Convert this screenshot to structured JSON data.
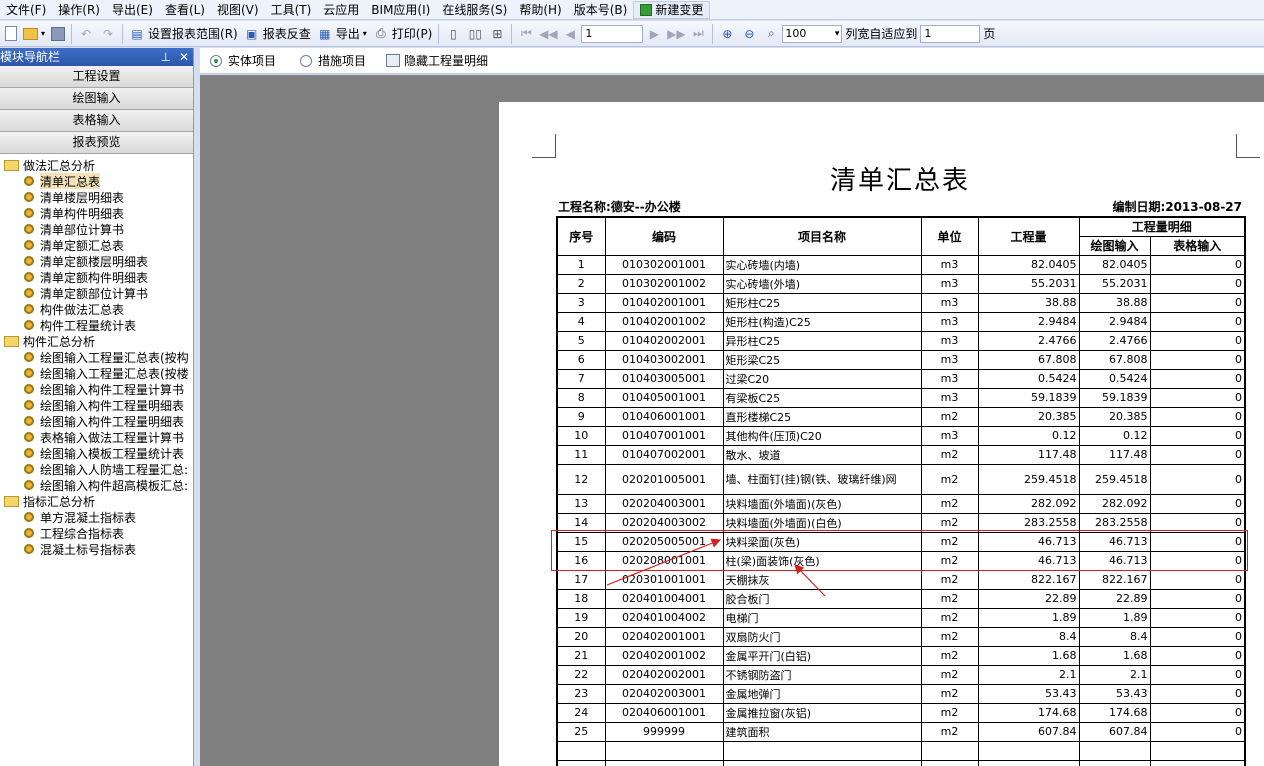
{
  "menu": [
    "文件(F)",
    "操作(R)",
    "导出(E)",
    "查看(L)",
    "视图(V)",
    "工具(T)",
    "云应用",
    "BIM应用(I)",
    "在线服务(S)",
    "帮助(H)",
    "版本号(B)"
  ],
  "menu_special": "新建变更",
  "toolbar": {
    "set_range": "设置报表范围(R)",
    "reverse": "报表反查",
    "export": "导出",
    "print": "打印(P)",
    "page_value": "1",
    "zoom_value": "100",
    "fit_label": "列宽自适应到",
    "fit_value": "1",
    "page_unit": "页"
  },
  "left_panel": {
    "title": "模块导航栏",
    "nav": [
      "工程设置",
      "绘图输入",
      "表格输入",
      "报表预览"
    ],
    "groups": [
      {
        "label": "做法汇总分析",
        "items": [
          "清单汇总表",
          "清单楼层明细表",
          "清单构件明细表",
          "清单部位计算书",
          "清单定额汇总表",
          "清单定额楼层明细表",
          "清单定额构件明细表",
          "清单定额部位计算书",
          "构件做法汇总表",
          "构件工程量统计表"
        ]
      },
      {
        "label": "构件汇总分析",
        "items": [
          "绘图输入工程量汇总表(按构",
          "绘图输入工程量汇总表(按楼",
          "绘图输入构件工程量计算书",
          "绘图输入构件工程量明细表",
          "绘图输入构件工程量明细表",
          "表格输入做法工程量计算书",
          "绘图输入模板工程量统计表",
          "绘图输入人防墙工程量汇总:",
          "绘图输入构件超高模板汇总:"
        ]
      },
      {
        "label": "指标汇总分析",
        "items": [
          "单方混凝土指标表",
          "工程综合指标表",
          "混凝土标号指标表"
        ]
      }
    ]
  },
  "tabs": {
    "entity": "实体项目",
    "measure": "措施项目",
    "hide": "隐藏工程量明细"
  },
  "report": {
    "title": "清单汇总表",
    "project": "工程名称:德安--办公楼",
    "date": "编制日期:2013-08-27",
    "headers": {
      "seq": "序号",
      "code": "编码",
      "name": "项目名称",
      "unit": "单位",
      "qty": "工程量",
      "detail": "工程量明细",
      "draw": "绘图输入",
      "table": "表格输入"
    },
    "rows": [
      {
        "seq": "1",
        "code": "010302001001",
        "name": "实心砖墙(内墙)",
        "unit": "m3",
        "qty": "82.0405",
        "draw": "82.0405",
        "table": "0"
      },
      {
        "seq": "2",
        "code": "010302001002",
        "name": "实心砖墙(外墙)",
        "unit": "m3",
        "qty": "55.2031",
        "draw": "55.2031",
        "table": "0"
      },
      {
        "seq": "3",
        "code": "010402001001",
        "name": "矩形柱C25",
        "unit": "m3",
        "qty": "38.88",
        "draw": "38.88",
        "table": "0"
      },
      {
        "seq": "4",
        "code": "010402001002",
        "name": "矩形柱(构造)C25",
        "unit": "m3",
        "qty": "2.9484",
        "draw": "2.9484",
        "table": "0"
      },
      {
        "seq": "5",
        "code": "010402002001",
        "name": "异形柱C25",
        "unit": "m3",
        "qty": "2.4766",
        "draw": "2.4766",
        "table": "0"
      },
      {
        "seq": "6",
        "code": "010403002001",
        "name": "矩形梁C25",
        "unit": "m3",
        "qty": "67.808",
        "draw": "67.808",
        "table": "0"
      },
      {
        "seq": "7",
        "code": "010403005001",
        "name": "过梁C20",
        "unit": "m3",
        "qty": "0.5424",
        "draw": "0.5424",
        "table": "0"
      },
      {
        "seq": "8",
        "code": "010405001001",
        "name": "有梁板C25",
        "unit": "m3",
        "qty": "59.1839",
        "draw": "59.1839",
        "table": "0"
      },
      {
        "seq": "9",
        "code": "010406001001",
        "name": "直形楼梯C25",
        "unit": "m2",
        "qty": "20.385",
        "draw": "20.385",
        "table": "0"
      },
      {
        "seq": "10",
        "code": "010407001001",
        "name": "其他构件(压顶)C20",
        "unit": "m3",
        "qty": "0.12",
        "draw": "0.12",
        "table": "0"
      },
      {
        "seq": "11",
        "code": "010407002001",
        "name": "散水、坡道",
        "unit": "m2",
        "qty": "117.48",
        "draw": "117.48",
        "table": "0"
      },
      {
        "seq": "12",
        "code": "020201005001",
        "name": "墙、柱面钉(挂)钢(铁、玻璃纤维)网",
        "unit": "m2",
        "qty": "259.4518",
        "draw": "259.4518",
        "table": "0"
      },
      {
        "seq": "13",
        "code": "020204003001",
        "name": "块料墙面(外墙面)(灰色)",
        "unit": "m2",
        "qty": "282.092",
        "draw": "282.092",
        "table": "0"
      },
      {
        "seq": "14",
        "code": "020204003002",
        "name": "块料墙面(外墙面)(白色)",
        "unit": "m2",
        "qty": "283.2558",
        "draw": "283.2558",
        "table": "0"
      },
      {
        "seq": "15",
        "code": "020205005001",
        "name": "块料梁面(灰色)",
        "unit": "m2",
        "qty": "46.713",
        "draw": "46.713",
        "table": "0"
      },
      {
        "seq": "16",
        "code": "020208001001",
        "name": "柱(梁)面装饰(灰色)",
        "unit": "m2",
        "qty": "46.713",
        "draw": "46.713",
        "table": "0"
      },
      {
        "seq": "17",
        "code": "020301001001",
        "name": "天棚抹灰",
        "unit": "m2",
        "qty": "822.167",
        "draw": "822.167",
        "table": "0"
      },
      {
        "seq": "18",
        "code": "020401004001",
        "name": "胶合板门",
        "unit": "m2",
        "qty": "22.89",
        "draw": "22.89",
        "table": "0"
      },
      {
        "seq": "19",
        "code": "020401004002",
        "name": "电梯门",
        "unit": "m2",
        "qty": "1.89",
        "draw": "1.89",
        "table": "0"
      },
      {
        "seq": "20",
        "code": "020402001001",
        "name": "双扇防火门",
        "unit": "m2",
        "qty": "8.4",
        "draw": "8.4",
        "table": "0"
      },
      {
        "seq": "21",
        "code": "020402001002",
        "name": "金属平开门(白铝)",
        "unit": "m2",
        "qty": "1.68",
        "draw": "1.68",
        "table": "0"
      },
      {
        "seq": "22",
        "code": "020402002001",
        "name": "不锈钢防盗门",
        "unit": "m2",
        "qty": "2.1",
        "draw": "2.1",
        "table": "0"
      },
      {
        "seq": "23",
        "code": "020402003001",
        "name": "金属地弹门",
        "unit": "m2",
        "qty": "53.43",
        "draw": "53.43",
        "table": "0"
      },
      {
        "seq": "24",
        "code": "020406001001",
        "name": "金属推拉窗(灰铝)",
        "unit": "m2",
        "qty": "174.68",
        "draw": "174.68",
        "table": "0"
      },
      {
        "seq": "25",
        "code": "999999",
        "name": "建筑面积",
        "unit": "m2",
        "qty": "607.84",
        "draw": "607.84",
        "table": "0"
      }
    ]
  },
  "colors": {
    "highlight": "#d42020",
    "panel_title": "#2a56a8"
  }
}
